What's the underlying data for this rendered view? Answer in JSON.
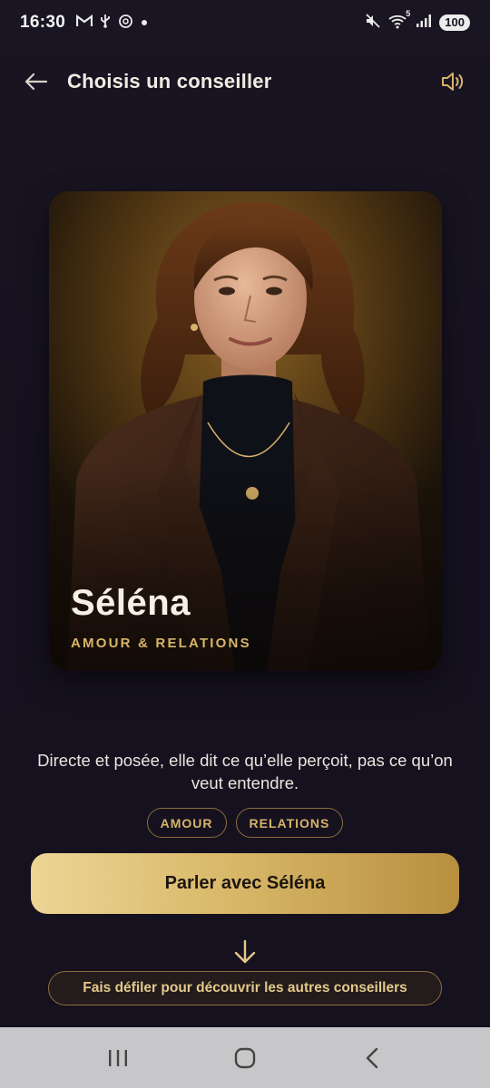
{
  "status_bar": {
    "time": "16:30",
    "left_icons": [
      "gmail-icon",
      "usb-icon",
      "openai-icon",
      "dot-icon"
    ],
    "right_icons": [
      "mute-icon",
      "wifi-icon",
      "signal-icon"
    ],
    "wifi_badge": "5",
    "battery": "100"
  },
  "header": {
    "back_icon": "arrow-left-icon",
    "title": "Choisis un conseiller",
    "sound_icon": "speaker-icon"
  },
  "advisor": {
    "name": "Séléna",
    "specialty": "AMOUR & RELATIONS",
    "description": "Directe et posée, elle dit ce qu’elle perçoit, pas ce qu’on veut entendre.",
    "tags": [
      "AMOUR",
      "RELATIONS"
    ]
  },
  "cta": {
    "label": "Parler avec Séléna"
  },
  "scroll": {
    "arrow_icon": "arrow-down-icon",
    "hint": "Fais défiler pour découvrir les autres conseillers"
  },
  "nav": {
    "recents_icon": "recents-icon",
    "home_icon": "home-icon",
    "back_icon": "back-chevron-icon"
  },
  "colors": {
    "background": "#16121d",
    "gold_accent": "#d7b46a",
    "cta_gradient_start": "#ecd595",
    "cta_gradient_end": "#b88f3f",
    "nav_bar": "#c7c7c9"
  }
}
